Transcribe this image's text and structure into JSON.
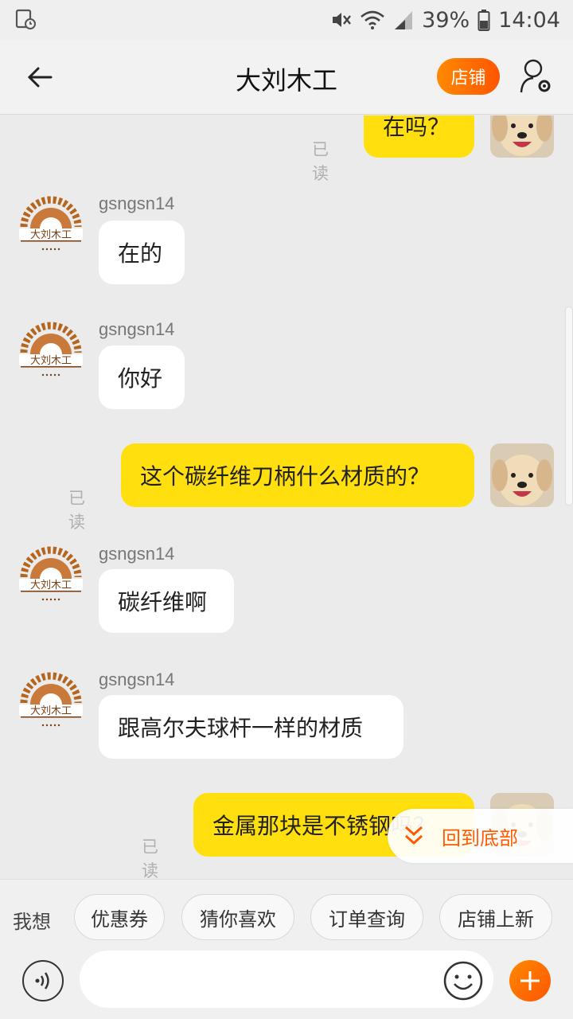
{
  "status_bar": {
    "battery": "39%",
    "time": "14:04"
  },
  "header": {
    "title": "大刘木工",
    "shop_label": "店铺"
  },
  "shop_avatar_text": "大刘木工",
  "messages": [
    {
      "dir": "out",
      "text": "在吗？",
      "read": "已读"
    },
    {
      "dir": "in",
      "sender": "gsngsn14",
      "text": "在的"
    },
    {
      "dir": "in",
      "sender": "gsngsn14",
      "text": "你好"
    },
    {
      "dir": "out",
      "text": "这个碳纤维刀柄什么材质的？",
      "read": "已读"
    },
    {
      "dir": "in",
      "sender": "gsngsn14",
      "text": "碳纤维啊"
    },
    {
      "dir": "in",
      "sender": "gsngsn14",
      "text": "跟高尔夫球杆一样的材质"
    },
    {
      "dir": "out",
      "text": "金属那块是不锈钢吗？",
      "read": "已读"
    }
  ],
  "jump_to_bottom": "回到底部",
  "quick_bar": {
    "label": "我想",
    "chips": [
      "优惠券",
      "猜你喜欢",
      "订单查询",
      "店铺上新"
    ]
  },
  "colors": {
    "accent": "#ff6a00",
    "out_bubble": "#ffdf0d",
    "in_bubble": "#ffffff"
  }
}
